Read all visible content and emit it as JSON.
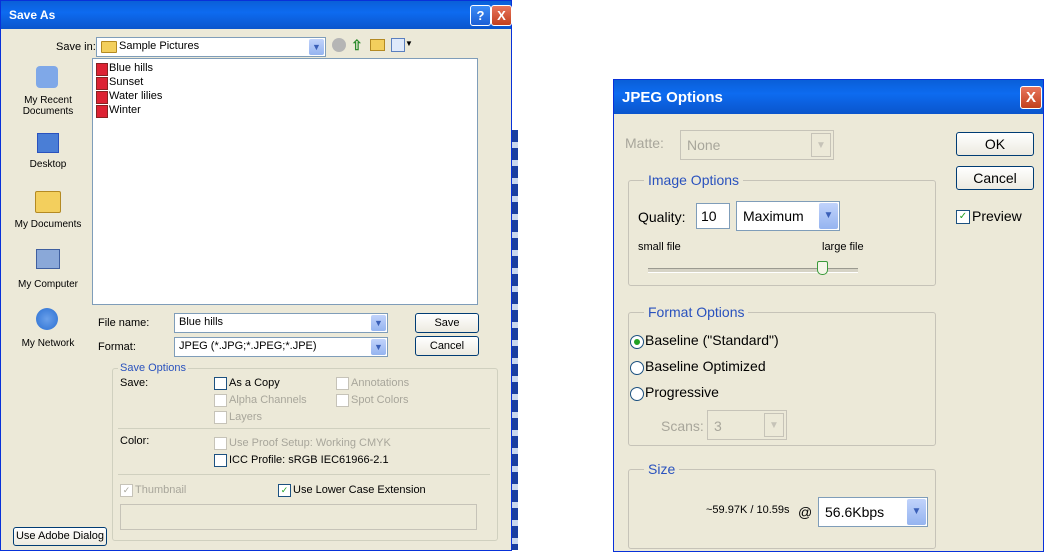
{
  "save_as": {
    "title": "Save As",
    "help_glyph": "?",
    "close_glyph": "X",
    "save_in_label": "Save in:",
    "save_in_value": "Sample Pictures",
    "places": [
      {
        "label": "My Recent Documents",
        "icon": "recent-documents-icon"
      },
      {
        "label": "Desktop",
        "icon": "desktop-icon"
      },
      {
        "label": "My Documents",
        "icon": "my-documents-icon"
      },
      {
        "label": "My Computer",
        "icon": "my-computer-icon"
      },
      {
        "label": "My Network",
        "icon": "my-network-icon"
      }
    ],
    "files": [
      "Blue hills",
      "Sunset",
      "Water lilies",
      "Winter"
    ],
    "file_name_label": "File name:",
    "file_name_value": "Blue hills",
    "format_label": "Format:",
    "format_value": "JPEG (*.JPG;*.JPEG;*.JPE)",
    "save_button": "Save",
    "cancel_button": "Cancel",
    "save_options": {
      "legend": "Save Options",
      "save_label": "Save:",
      "as_a_copy": "As a Copy",
      "alpha_channels": "Alpha Channels",
      "layers": "Layers",
      "annotations": "Annotations",
      "spot_colors": "Spot Colors",
      "color_label": "Color:",
      "use_proof_setup": "Use Proof Setup:  Working CMYK",
      "icc_profile": "ICC Profile:  sRGB IEC61966-2.1",
      "thumbnail": "Thumbnail",
      "use_lower_case": "Use Lower Case Extension"
    },
    "use_adobe_dialog": "Use Adobe Dialog"
  },
  "jpeg_options": {
    "title": "JPEG Options",
    "close_glyph": "X",
    "matte_label": "Matte:",
    "matte_value": "None",
    "ok_button": "OK",
    "cancel_button": "Cancel",
    "preview_label": "Preview",
    "image_options_legend": "Image Options",
    "quality_label": "Quality:",
    "quality_value": "10",
    "quality_preset": "Maximum",
    "small_file": "small file",
    "large_file": "large file",
    "quality_slider_fraction": 0.83,
    "format_options_legend": "Format Options",
    "baseline_standard": "Baseline (\"Standard\")",
    "baseline_optimized": "Baseline Optimized",
    "progressive": "Progressive",
    "scans_label": "Scans:",
    "scans_value": "3",
    "size_legend": "Size",
    "size_estimate": "~59.97K / 10.59s",
    "at_symbol": "@",
    "speed_value": "56.6Kbps"
  },
  "colors": {
    "xp_title": "#0a5fd8",
    "dialog_bg": "#ece9d8",
    "close_red": "#c2401d",
    "accent_blue": "#2a52be"
  }
}
